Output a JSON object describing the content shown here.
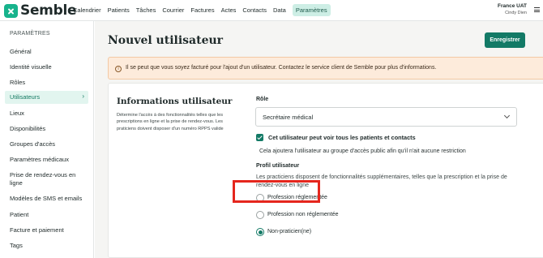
{
  "app": {
    "brand": "Semble"
  },
  "nav": {
    "items": [
      {
        "label": "Calendrier"
      },
      {
        "label": "Patients"
      },
      {
        "label": "Tâches"
      },
      {
        "label": "Courrier"
      },
      {
        "label": "Factures"
      },
      {
        "label": "Actes"
      },
      {
        "label": "Contacts"
      },
      {
        "label": "Data"
      },
      {
        "label": "Paramètres",
        "active": true
      }
    ]
  },
  "user": {
    "org": "France UAT",
    "name": "Cindy Dien"
  },
  "sidebar": {
    "title": "PARAMÈTRES",
    "items": [
      {
        "label": "Général"
      },
      {
        "label": "Identité visuelle"
      },
      {
        "label": "Rôles"
      },
      {
        "label": "Utilisateurs",
        "active": true
      },
      {
        "label": "Lieux"
      },
      {
        "label": "Disponibilités"
      },
      {
        "label": "Groupes d'accès"
      },
      {
        "label": "Paramètres médicaux"
      },
      {
        "label": "Prise de rendez-vous en ligne"
      },
      {
        "label": "Modèles de SMS et emails"
      },
      {
        "label": "Patient"
      },
      {
        "label": "Facture et paiement"
      },
      {
        "label": "Tags"
      }
    ]
  },
  "page": {
    "title": "Nouvel utilisateur",
    "save_label": "Enregistrer",
    "alert": "Il se peut que vous soyez facturé pour l'ajout d'un utilisateur. Contactez le service client de Semble pour plus d'informations."
  },
  "card": {
    "title": "Informations utilisateur",
    "description": "Détermine l'accès à des fonctionnalités telles que les prescriptions en ligne et la prise de rendez-vous. Les praticiens doivent disposer d'un numéro RPPS valide",
    "role_label": "Rôle",
    "role_value": "Secrétaire médical",
    "checkbox_label": "Cet utilisateur peut voir tous les patients et contacts",
    "checkbox_checked": true,
    "checkbox_hint": "Cela ajoutera l'utilisateur au groupe d'accès public afin qu'il n'ait aucune restriction",
    "profil_label": "Profil utilisateur",
    "profil_description": "Les practiciens disposent de fonctionnalités supplémentaires, telles que la prescription et la prise de rendez-vous en ligne",
    "options": [
      {
        "label": "Profession réglementée",
        "selected": false
      },
      {
        "label": "Profession non réglementée",
        "selected": false
      },
      {
        "label": "Non-praticien(ne)",
        "selected": true
      }
    ]
  },
  "colors": {
    "accent": "#137a66",
    "highlight": "#e5261d",
    "alert_bg": "#fdebdb"
  }
}
